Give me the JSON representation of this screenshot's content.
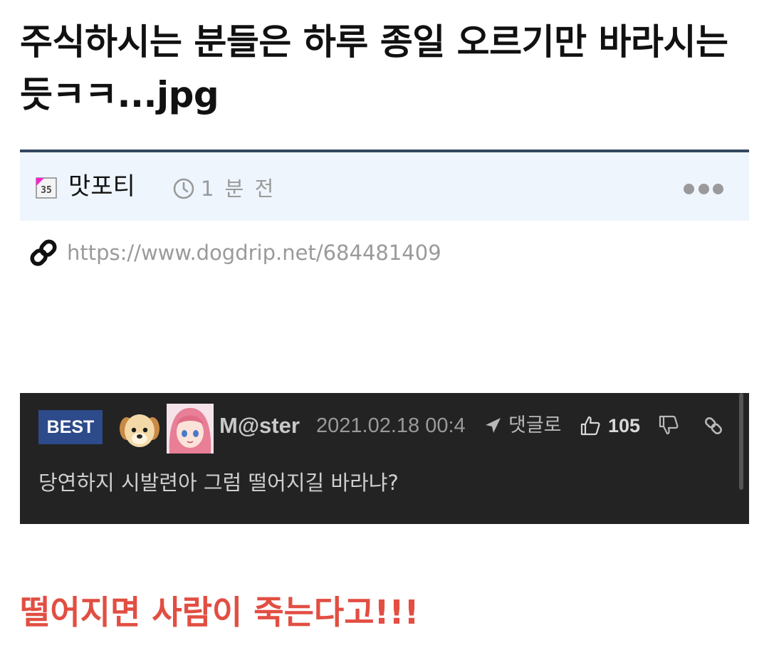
{
  "post": {
    "title": "주식하시는 분들은 하루 종일 오르기만 바라시는 듯ㅋㅋ...jpg",
    "author": "맛포티",
    "level_badge": "35",
    "time_ago": "1 분 전",
    "url": "https://www.dogdrip.net/684481409",
    "punchline": "떨어지면 사람이 죽는다고!!!"
  },
  "comment": {
    "badge": "BEST",
    "nickname": "M@ster",
    "date": "2021.02.18 00:4",
    "reply_label": "댓글로",
    "likes": "105",
    "text": "당연하지 시발련아 그럼 떨어지길 바라냐?"
  },
  "colors": {
    "title": "#111111",
    "meta_border": "#33475f",
    "meta_bg": "#eef5fd",
    "comment_bg": "#232323",
    "best_badge": "#2d4a8a",
    "punchline": "#e24e42"
  },
  "icons": [
    "level-badge-icon",
    "clock-icon",
    "more-icon",
    "link-icon",
    "reply-arrow-icon",
    "thumbs-up-icon",
    "thumbs-down-icon",
    "clip-icon"
  ]
}
